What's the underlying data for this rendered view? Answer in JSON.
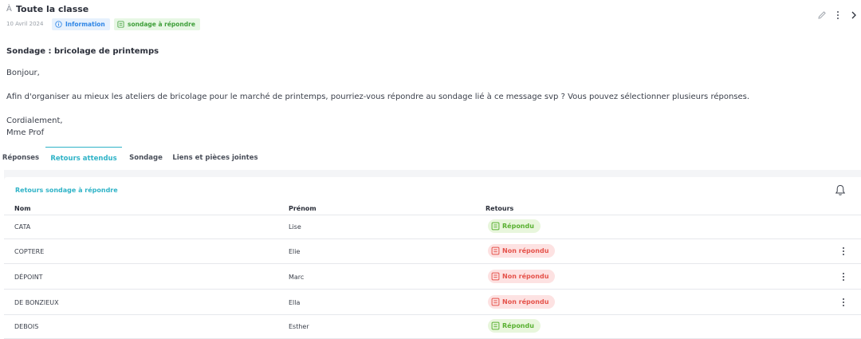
{
  "header": {
    "to_prefix": "À",
    "recipient": "Toute la classe",
    "date": "10 Avril 2024",
    "badges": [
      {
        "label": "Information",
        "icon": "info-circle-icon",
        "color": "#2f86e6"
      },
      {
        "label": "sondage à répondre",
        "icon": "form-icon",
        "color": "#3f9f3a"
      }
    ],
    "actions": [
      "edit-icon",
      "more-vertical-icon",
      "chevron-right-icon"
    ]
  },
  "message": {
    "title": "Sondage : bricolage de printemps",
    "greeting": "Bonjour,",
    "body": "Afin d'organiser au mieux les ateliers de bricolage pour le marché de printemps, pourriez-vous répondre au sondage lié à ce message svp ? Vous pouvez sélectionner plusieurs réponses.",
    "closing": "Cordialement,",
    "signature": "Mme Prof"
  },
  "tabs": [
    {
      "label": "Réponses",
      "active": false
    },
    {
      "label": "Retours attendus",
      "active": true
    },
    {
      "label": "Sondage",
      "active": false
    },
    {
      "label": "Liens et pièces jointes",
      "active": false
    }
  ],
  "table": {
    "title": "Retours sondage à répondre",
    "headers": {
      "nom": "Nom",
      "prenom": "Prénom",
      "retours": "Retours"
    },
    "rows": [
      {
        "nom": "CATA",
        "prenom": "Lise",
        "status": "Répondu",
        "answered": true
      },
      {
        "nom": "COPTERE",
        "prenom": "Elie",
        "status": "Non répondu",
        "answered": false
      },
      {
        "nom": "DÉPOINT",
        "prenom": "Marc",
        "status": "Non répondu",
        "answered": false
      },
      {
        "nom": "DE BONZIEUX",
        "prenom": "Ella",
        "status": "Non répondu",
        "answered": false
      },
      {
        "nom": "DEBOIS",
        "prenom": "Esther",
        "status": "Répondu",
        "answered": true
      }
    ]
  },
  "colors": {
    "accent": "#2fb3c7",
    "answered": "#58b030",
    "not_answered": "#e5534b"
  }
}
